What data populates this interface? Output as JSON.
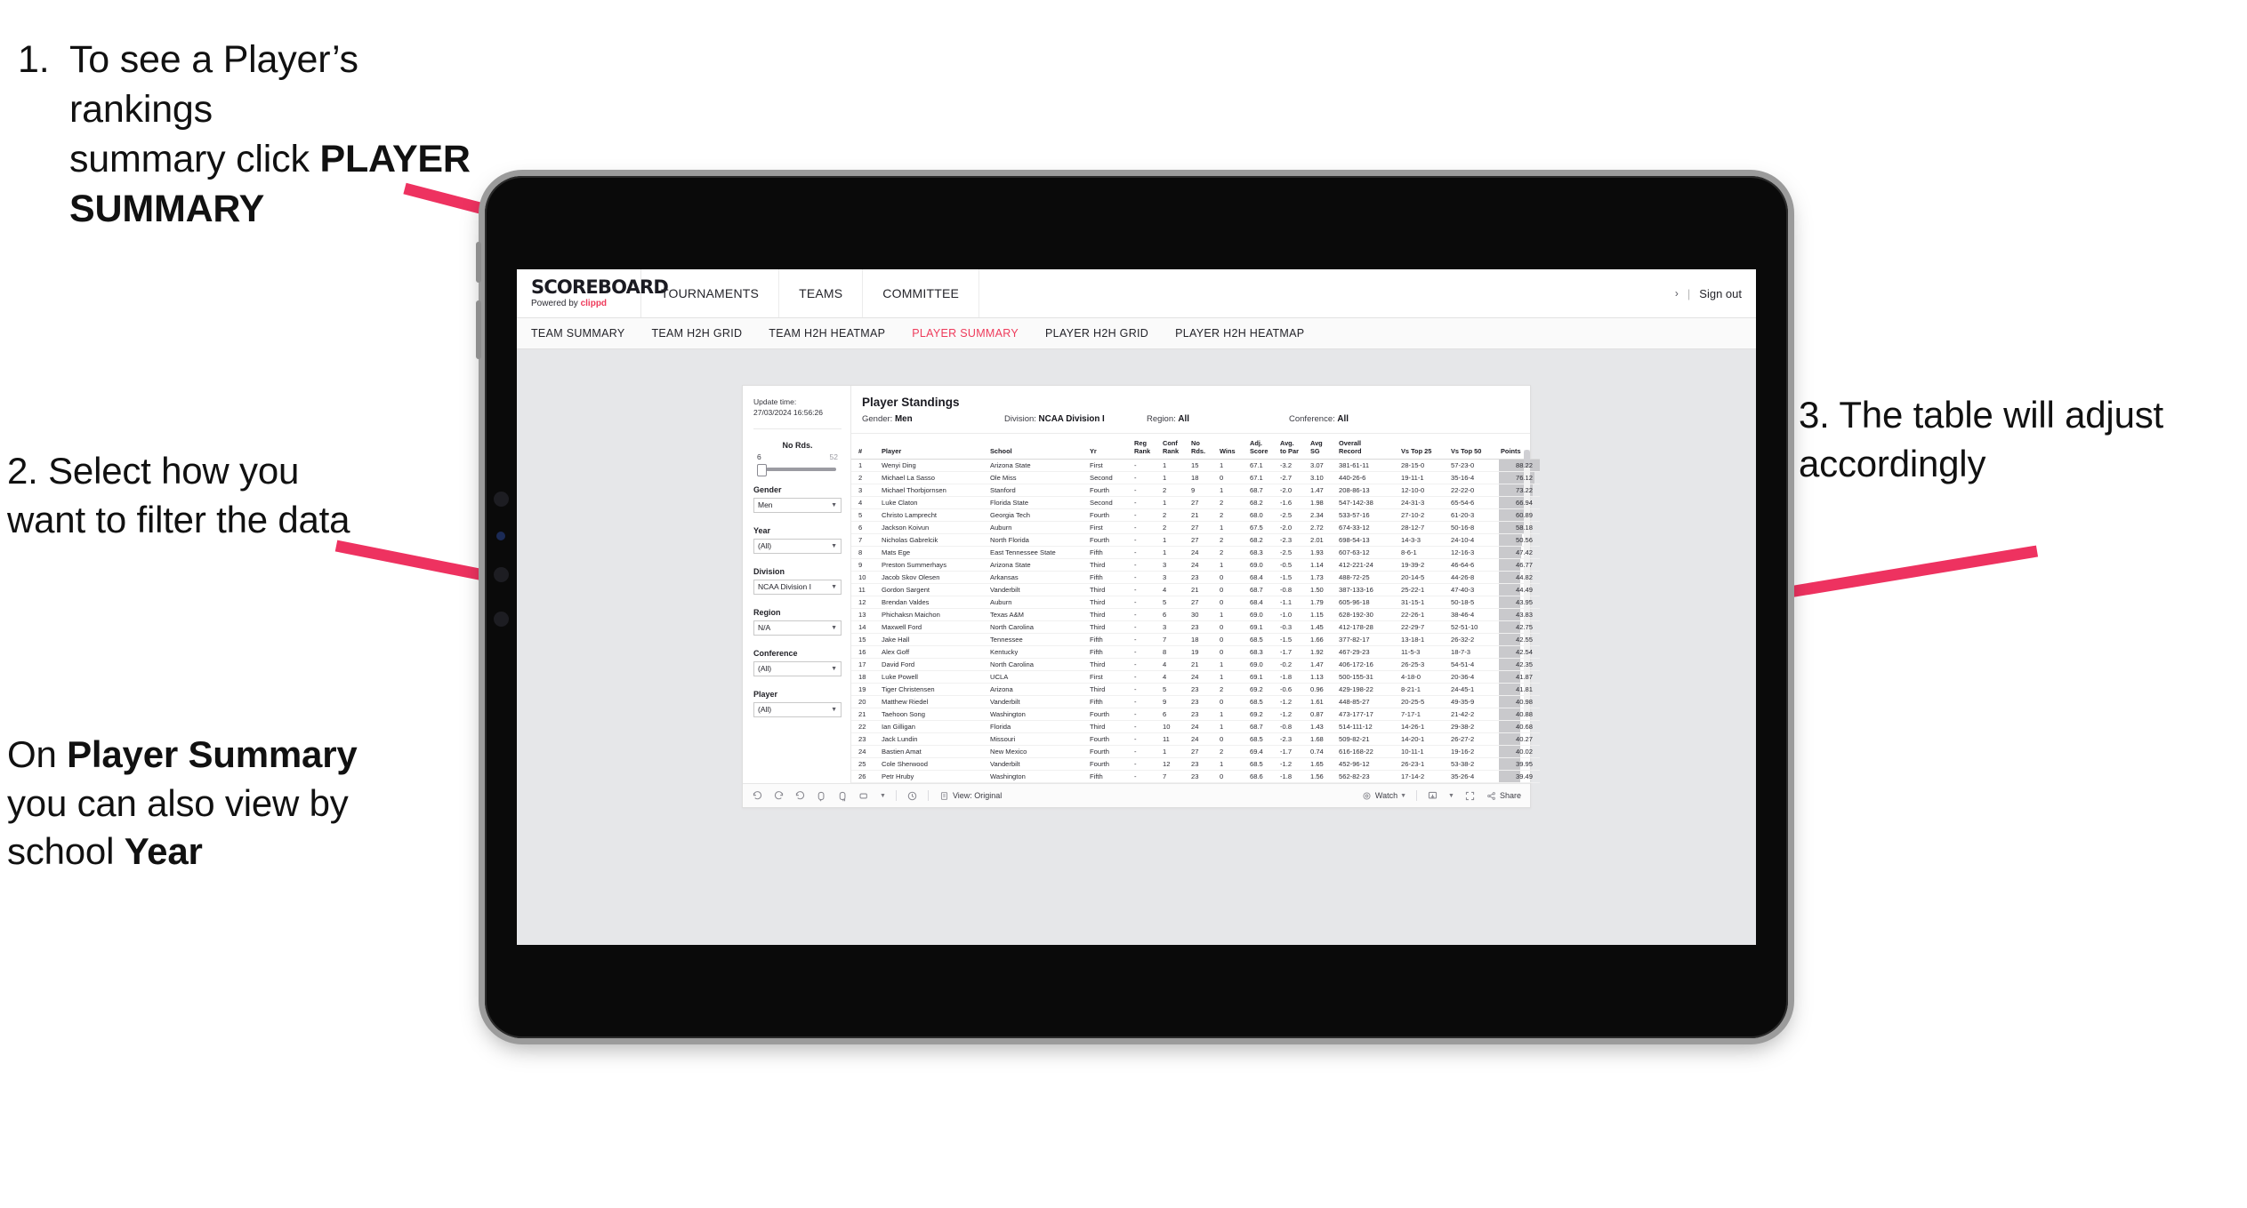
{
  "annotations": {
    "step1": {
      "number": "1.",
      "line1": "To see a Player’s rankings",
      "line2_prefix": "summary click ",
      "line2_bold": "PLAYER",
      "line3_bold": "SUMMARY"
    },
    "step2": {
      "text": "2. Select how you want to filter the data"
    },
    "step2b": {
      "p1": "On ",
      "b1": "Player Summary",
      "p2": " you can also view by school ",
      "b2": "Year"
    },
    "step3": {
      "text": "3. The table will adjust accordingly"
    },
    "arrow_color": "#ee3260"
  },
  "app": {
    "brand": {
      "name": "SCOREBOARD",
      "powered_prefix": "Powered by ",
      "powered_brand": "clippd"
    },
    "top_nav": [
      "TOURNAMENTS",
      "TEAMS",
      "COMMITTEE"
    ],
    "top_right": {
      "chevron": "›",
      "separator": "|",
      "sign_out": "Sign out"
    },
    "sub_nav": [
      {
        "label": "TEAM SUMMARY",
        "active": false
      },
      {
        "label": "TEAM H2H GRID",
        "active": false
      },
      {
        "label": "TEAM H2H HEATMAP",
        "active": false
      },
      {
        "label": "PLAYER SUMMARY",
        "active": true
      },
      {
        "label": "PLAYER H2H GRID",
        "active": false
      },
      {
        "label": "PLAYER H2H HEATMAP",
        "active": false
      }
    ],
    "accent_color": "#ee3b5b"
  },
  "filters": {
    "update_time_label": "Update time:",
    "update_time_value": "27/03/2024 16:56:26",
    "slider": {
      "label": "No Rds.",
      "min": "6",
      "max": "52"
    },
    "controls": [
      {
        "label": "Gender",
        "value": "Men"
      },
      {
        "label": "Year",
        "value": "(All)"
      },
      {
        "label": "Division",
        "value": "NCAA Division I"
      },
      {
        "label": "Region",
        "value": "N/A"
      },
      {
        "label": "Conference",
        "value": "(All)"
      },
      {
        "label": "Player",
        "value": "(All)"
      }
    ]
  },
  "viz": {
    "title": "Player Standings",
    "params": [
      {
        "label": "Gender:",
        "value": "Men"
      },
      {
        "label": "Division:",
        "value": "NCAA Division I"
      },
      {
        "label": "Region:",
        "value": "All"
      },
      {
        "label": "Conference:",
        "value": "All"
      }
    ],
    "columns": [
      {
        "l1": "#",
        "l2": ""
      },
      {
        "l1": "Player",
        "l2": ""
      },
      {
        "l1": "School",
        "l2": ""
      },
      {
        "l1": "Yr",
        "l2": ""
      },
      {
        "l1": "Reg",
        "l2": "Rank"
      },
      {
        "l1": "Conf",
        "l2": "Rank"
      },
      {
        "l1": "No",
        "l2": "Rds."
      },
      {
        "l1": "Wins",
        "l2": ""
      },
      {
        "l1": "Adj.",
        "l2": "Score"
      },
      {
        "l1": "Avg.",
        "l2": "to Par"
      },
      {
        "l1": "Avg",
        "l2": "SG"
      },
      {
        "l1": "Overall",
        "l2": "Record"
      },
      {
        "l1": "Vs Top 25",
        "l2": ""
      },
      {
        "l1": "Vs Top 50",
        "l2": ""
      },
      {
        "l1": "Points",
        "l2": ""
      }
    ],
    "rows": [
      {
        "rank": "1",
        "player": "Wenyi Ding",
        "school": "Arizona State",
        "yr": "First",
        "reg": "-",
        "conf": "1",
        "rds": "15",
        "wins": "1",
        "adj": "67.1",
        "par": "-3.2",
        "sg": "3.07",
        "rec": "381-61-11",
        "t25": "28-15-0",
        "t50": "57-23-0",
        "pts": "88.22"
      },
      {
        "rank": "2",
        "player": "Michael La Sasso",
        "school": "Ole Miss",
        "yr": "Second",
        "reg": "-",
        "conf": "1",
        "rds": "18",
        "wins": "0",
        "adj": "67.1",
        "par": "-2.7",
        "sg": "3.10",
        "rec": "440-26-6",
        "t25": "19-11-1",
        "t50": "35-16-4",
        "pts": "76.12"
      },
      {
        "rank": "3",
        "player": "Michael Thorbjornsen",
        "school": "Stanford",
        "yr": "Fourth",
        "reg": "-",
        "conf": "2",
        "rds": "9",
        "wins": "1",
        "adj": "68.7",
        "par": "-2.0",
        "sg": "1.47",
        "rec": "208-86-13",
        "t25": "12-10-0",
        "t50": "22-22-0",
        "pts": "73.22"
      },
      {
        "rank": "4",
        "player": "Luke Claton",
        "school": "Florida State",
        "yr": "Second",
        "reg": "-",
        "conf": "1",
        "rds": "27",
        "wins": "2",
        "adj": "68.2",
        "par": "-1.6",
        "sg": "1.98",
        "rec": "547-142-38",
        "t25": "24-31-3",
        "t50": "65-54-6",
        "pts": "66.94"
      },
      {
        "rank": "5",
        "player": "Christo Lamprecht",
        "school": "Georgia Tech",
        "yr": "Fourth",
        "reg": "-",
        "conf": "2",
        "rds": "21",
        "wins": "2",
        "adj": "68.0",
        "par": "-2.5",
        "sg": "2.34",
        "rec": "533-57-16",
        "t25": "27-10-2",
        "t50": "61-20-3",
        "pts": "60.89"
      },
      {
        "rank": "6",
        "player": "Jackson Koivun",
        "school": "Auburn",
        "yr": "First",
        "reg": "-",
        "conf": "2",
        "rds": "27",
        "wins": "1",
        "adj": "67.5",
        "par": "-2.0",
        "sg": "2.72",
        "rec": "674-33-12",
        "t25": "28-12-7",
        "t50": "50-16-8",
        "pts": "58.18"
      },
      {
        "rank": "7",
        "player": "Nicholas Gabrelcik",
        "school": "North Florida",
        "yr": "Fourth",
        "reg": "-",
        "conf": "1",
        "rds": "27",
        "wins": "2",
        "adj": "68.2",
        "par": "-2.3",
        "sg": "2.01",
        "rec": "698-54-13",
        "t25": "14-3-3",
        "t50": "24-10-4",
        "pts": "50.56"
      },
      {
        "rank": "8",
        "player": "Mats Ege",
        "school": "East Tennessee State",
        "yr": "Fifth",
        "reg": "-",
        "conf": "1",
        "rds": "24",
        "wins": "2",
        "adj": "68.3",
        "par": "-2.5",
        "sg": "1.93",
        "rec": "607-63-12",
        "t25": "8-6-1",
        "t50": "12-16-3",
        "pts": "47.42"
      },
      {
        "rank": "9",
        "player": "Preston Summerhays",
        "school": "Arizona State",
        "yr": "Third",
        "reg": "-",
        "conf": "3",
        "rds": "24",
        "wins": "1",
        "adj": "69.0",
        "par": "-0.5",
        "sg": "1.14",
        "rec": "412-221-24",
        "t25": "19-39-2",
        "t50": "46-64-6",
        "pts": "46.77"
      },
      {
        "rank": "10",
        "player": "Jacob Skov Olesen",
        "school": "Arkansas",
        "yr": "Fifth",
        "reg": "-",
        "conf": "3",
        "rds": "23",
        "wins": "0",
        "adj": "68.4",
        "par": "-1.5",
        "sg": "1.73",
        "rec": "488-72-25",
        "t25": "20-14-5",
        "t50": "44-26-8",
        "pts": "44.82"
      },
      {
        "rank": "11",
        "player": "Gordon Sargent",
        "school": "Vanderbilt",
        "yr": "Third",
        "reg": "-",
        "conf": "4",
        "rds": "21",
        "wins": "0",
        "adj": "68.7",
        "par": "-0.8",
        "sg": "1.50",
        "rec": "387-133-16",
        "t25": "25-22-1",
        "t50": "47-40-3",
        "pts": "44.49"
      },
      {
        "rank": "12",
        "player": "Brendan Valdes",
        "school": "Auburn",
        "yr": "Third",
        "reg": "-",
        "conf": "5",
        "rds": "27",
        "wins": "0",
        "adj": "68.4",
        "par": "-1.1",
        "sg": "1.79",
        "rec": "605-96-18",
        "t25": "31-15-1",
        "t50": "50-18-5",
        "pts": "43.95"
      },
      {
        "rank": "13",
        "player": "Phichaksn Maichon",
        "school": "Texas A&M",
        "yr": "Third",
        "reg": "-",
        "conf": "6",
        "rds": "30",
        "wins": "1",
        "adj": "69.0",
        "par": "-1.0",
        "sg": "1.15",
        "rec": "628-192-30",
        "t25": "22-26-1",
        "t50": "38-46-4",
        "pts": "43.83"
      },
      {
        "rank": "14",
        "player": "Maxwell Ford",
        "school": "North Carolina",
        "yr": "Third",
        "reg": "-",
        "conf": "3",
        "rds": "23",
        "wins": "0",
        "adj": "69.1",
        "par": "-0.3",
        "sg": "1.45",
        "rec": "412-178-28",
        "t25": "22-29-7",
        "t50": "52-51-10",
        "pts": "42.75"
      },
      {
        "rank": "15",
        "player": "Jake Hall",
        "school": "Tennessee",
        "yr": "Fifth",
        "reg": "-",
        "conf": "7",
        "rds": "18",
        "wins": "0",
        "adj": "68.5",
        "par": "-1.5",
        "sg": "1.66",
        "rec": "377-82-17",
        "t25": "13-18-1",
        "t50": "26-32-2",
        "pts": "42.55"
      },
      {
        "rank": "16",
        "player": "Alex Goff",
        "school": "Kentucky",
        "yr": "Fifth",
        "reg": "-",
        "conf": "8",
        "rds": "19",
        "wins": "0",
        "adj": "68.3",
        "par": "-1.7",
        "sg": "1.92",
        "rec": "467-29-23",
        "t25": "11-5-3",
        "t50": "18-7-3",
        "pts": "42.54"
      },
      {
        "rank": "17",
        "player": "David Ford",
        "school": "North Carolina",
        "yr": "Third",
        "reg": "-",
        "conf": "4",
        "rds": "21",
        "wins": "1",
        "adj": "69.0",
        "par": "-0.2",
        "sg": "1.47",
        "rec": "406-172-16",
        "t25": "26-25-3",
        "t50": "54-51-4",
        "pts": "42.35"
      },
      {
        "rank": "18",
        "player": "Luke Powell",
        "school": "UCLA",
        "yr": "First",
        "reg": "-",
        "conf": "4",
        "rds": "24",
        "wins": "1",
        "adj": "69.1",
        "par": "-1.8",
        "sg": "1.13",
        "rec": "500-155-31",
        "t25": "4-18-0",
        "t50": "20-36-4",
        "pts": "41.87"
      },
      {
        "rank": "19",
        "player": "Tiger Christensen",
        "school": "Arizona",
        "yr": "Third",
        "reg": "-",
        "conf": "5",
        "rds": "23",
        "wins": "2",
        "adj": "69.2",
        "par": "-0.6",
        "sg": "0.96",
        "rec": "429-198-22",
        "t25": "8-21-1",
        "t50": "24-45-1",
        "pts": "41.81"
      },
      {
        "rank": "20",
        "player": "Matthew Riedel",
        "school": "Vanderbilt",
        "yr": "Fifth",
        "reg": "-",
        "conf": "9",
        "rds": "23",
        "wins": "0",
        "adj": "68.5",
        "par": "-1.2",
        "sg": "1.61",
        "rec": "448-85-27",
        "t25": "20-25-5",
        "t50": "49-35-9",
        "pts": "40.98"
      },
      {
        "rank": "21",
        "player": "Taehoon Song",
        "school": "Washington",
        "yr": "Fourth",
        "reg": "-",
        "conf": "6",
        "rds": "23",
        "wins": "1",
        "adj": "69.2",
        "par": "-1.2",
        "sg": "0.87",
        "rec": "473-177-17",
        "t25": "7-17-1",
        "t50": "21-42-2",
        "pts": "40.88"
      },
      {
        "rank": "22",
        "player": "Ian Gilligan",
        "school": "Florida",
        "yr": "Third",
        "reg": "-",
        "conf": "10",
        "rds": "24",
        "wins": "1",
        "adj": "68.7",
        "par": "-0.8",
        "sg": "1.43",
        "rec": "514-111-12",
        "t25": "14-26-1",
        "t50": "29-38-2",
        "pts": "40.68"
      },
      {
        "rank": "23",
        "player": "Jack Lundin",
        "school": "Missouri",
        "yr": "Fourth",
        "reg": "-",
        "conf": "11",
        "rds": "24",
        "wins": "0",
        "adj": "68.5",
        "par": "-2.3",
        "sg": "1.68",
        "rec": "509-82-21",
        "t25": "14-20-1",
        "t50": "26-27-2",
        "pts": "40.27"
      },
      {
        "rank": "24",
        "player": "Bastien Amat",
        "school": "New Mexico",
        "yr": "Fourth",
        "reg": "-",
        "conf": "1",
        "rds": "27",
        "wins": "2",
        "adj": "69.4",
        "par": "-1.7",
        "sg": "0.74",
        "rec": "616-168-22",
        "t25": "10-11-1",
        "t50": "19-16-2",
        "pts": "40.02"
      },
      {
        "rank": "25",
        "player": "Cole Sherwood",
        "school": "Vanderbilt",
        "yr": "Fourth",
        "reg": "-",
        "conf": "12",
        "rds": "23",
        "wins": "1",
        "adj": "68.5",
        "par": "-1.2",
        "sg": "1.65",
        "rec": "452-96-12",
        "t25": "26-23-1",
        "t50": "53-38-2",
        "pts": "39.95"
      },
      {
        "rank": "26",
        "player": "Petr Hruby",
        "school": "Washington",
        "yr": "Fifth",
        "reg": "-",
        "conf": "7",
        "rds": "23",
        "wins": "0",
        "adj": "68.6",
        "par": "-1.8",
        "sg": "1.56",
        "rec": "562-82-23",
        "t25": "17-14-2",
        "t50": "35-26-4",
        "pts": "39.49"
      }
    ]
  },
  "toolbar": {
    "view_label": "View: Original",
    "watch_label": "Watch",
    "share_label": "Share",
    "icons": [
      "undo-icon",
      "redo-icon",
      "revert-icon",
      "refresh-icon",
      "pause-icon",
      "device-layout-icon",
      "history-icon",
      "view-icon",
      "watch-icon",
      "download-icon",
      "fullscreen-icon",
      "share-icon"
    ]
  }
}
